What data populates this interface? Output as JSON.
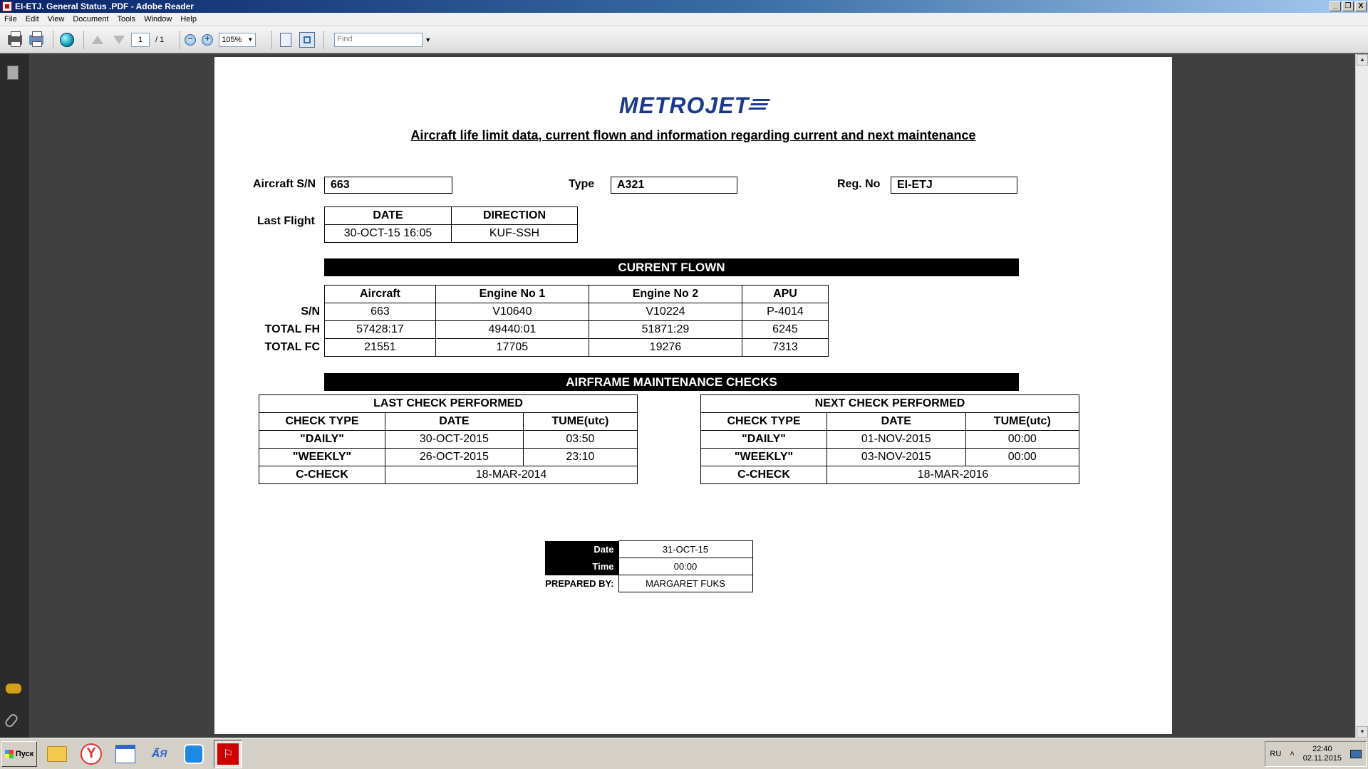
{
  "window": {
    "title": "EI-ETJ. General Status .PDF - Adobe Reader",
    "min": "_",
    "restore": "❐",
    "close": "X"
  },
  "menu": [
    "File",
    "Edit",
    "View",
    "Document",
    "Tools",
    "Window",
    "Help"
  ],
  "toolbar": {
    "page_current": "1",
    "page_total": "/ 1",
    "zoom": "105%",
    "zoom_out": "−",
    "zoom_in": "+",
    "find_placeholder": "Find"
  },
  "document": {
    "logo": "METROJET",
    "heading": "Aircraft life limit data, current flown and information regarding current and next maintenance",
    "aircraft_sn_label": "Aircraft S/N",
    "aircraft_sn": "663",
    "type_label": "Type",
    "type": "A321",
    "reg_label": "Reg. No",
    "reg": "EI-ETJ",
    "last_flight": {
      "label": "Last Flight",
      "headers": [
        "DATE",
        "DIRECTION"
      ],
      "values": [
        "30-OCT-15 16:05",
        "KUF-SSH"
      ]
    },
    "current_flown": {
      "title": "CURRENT FLOWN",
      "headers": [
        "Aircraft",
        "Engine No 1",
        "Engine No 2",
        "APU"
      ],
      "row_labels": [
        "S/N",
        "TOTAL FH",
        "TOTAL FC"
      ],
      "rows": [
        [
          "663",
          "V10640",
          "V10224",
          "P-4014"
        ],
        [
          "57428:17",
          "49440:01",
          "51871:29",
          "6245"
        ],
        [
          "21551",
          "17705",
          "19276",
          "7313"
        ]
      ]
    },
    "checks": {
      "title": "AIRFRAME MAINTENANCE CHECKS",
      "last": {
        "title": "LAST CHECK PERFORMED",
        "headers": [
          "CHECK TYPE",
          "DATE",
          "TUME(utc)"
        ],
        "rows": [
          [
            "\"DAILY\"",
            "30-OCT-2015",
            "03:50"
          ],
          [
            "\"WEEKLY\"",
            "26-OCT-2015",
            "23:10"
          ]
        ],
        "ccheck": [
          "C-CHECK",
          "18-MAR-2014"
        ]
      },
      "next": {
        "title": "NEXT CHECK PERFORMED",
        "headers": [
          "CHECK TYPE",
          "DATE",
          "TUME(utc)"
        ],
        "rows": [
          [
            "\"DAILY\"",
            "01-NOV-2015",
            "00:00"
          ],
          [
            "\"WEEKLY\"",
            "03-NOV-2015",
            "00:00"
          ]
        ],
        "ccheck": [
          "C-CHECK",
          "18-MAR-2016"
        ]
      }
    },
    "prepared": {
      "date_label": "Date",
      "date": "31-OCT-15",
      "time_label": "Time",
      "time": "00:00",
      "by_label": "PREPARED BY:",
      "by": "MARGARET FUKS"
    }
  },
  "taskbar": {
    "start": "Пуск",
    "yandex": "Y",
    "lang_app": "A⃗Я",
    "pdf": "⚐",
    "lang": "RU",
    "chevron": "˄",
    "time": "22:40",
    "date": "02.11.2015"
  }
}
